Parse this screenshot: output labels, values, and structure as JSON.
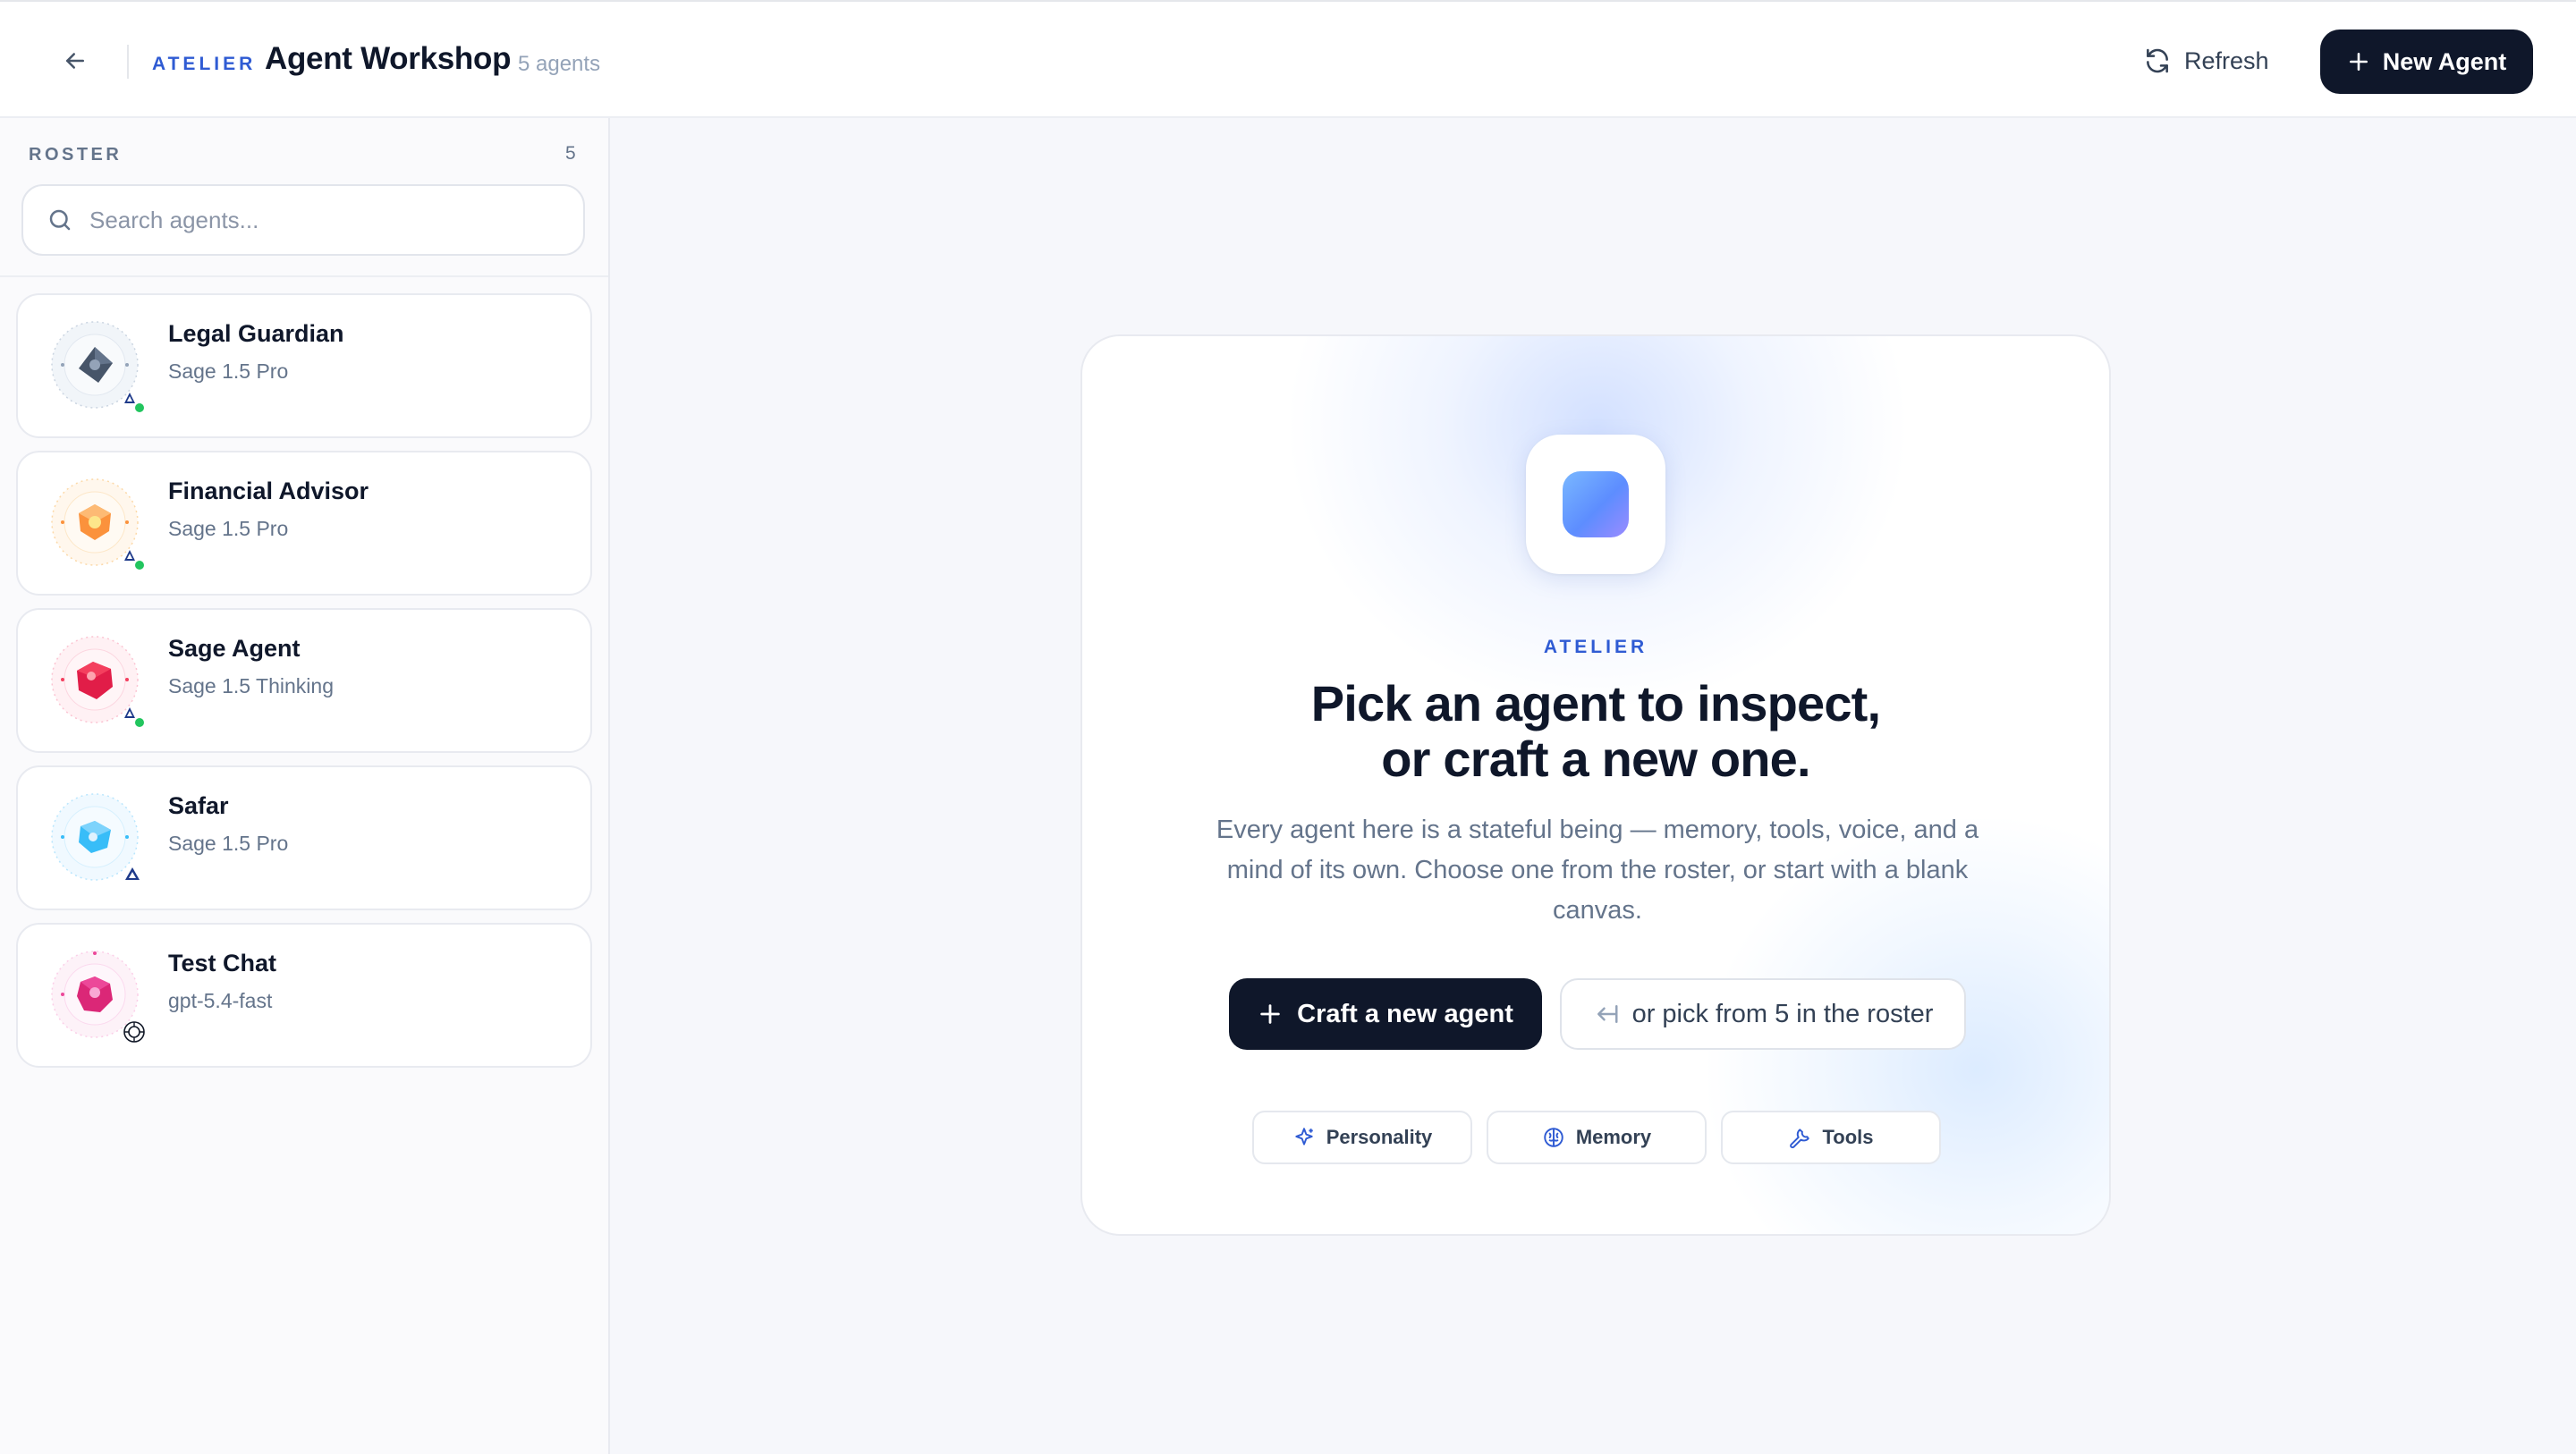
{
  "header": {
    "brand": "ATELIER",
    "title": "Agent Workshop",
    "count_label": "5 agents",
    "refresh_label": "Refresh",
    "new_agent_label": "New Agent"
  },
  "sidebar": {
    "roster_label": "ROSTER",
    "roster_count": "5",
    "search_placeholder": "Search agents...",
    "agents": [
      {
        "name": "Legal Guardian",
        "model": "Sage 1.5 Pro",
        "color": "#475569",
        "ring": "#cbd5e1",
        "badge": "provider-icon",
        "online": true
      },
      {
        "name": "Financial Advisor",
        "model": "Sage 1.5 Pro",
        "color": "#f97316",
        "ring": "#fcd9a8",
        "badge": "provider-icon",
        "online": true
      },
      {
        "name": "Sage Agent",
        "model": "Sage 1.5 Thinking",
        "color": "#e11d48",
        "ring": "#fbc4d2",
        "badge": "provider-icon",
        "online": true
      },
      {
        "name": "Safar",
        "model": "Sage 1.5 Pro",
        "color": "#0ea5e9",
        "ring": "#bae6fd",
        "badge": "provider-icon",
        "online": false
      },
      {
        "name": "Test Chat",
        "model": "gpt-5.4-fast",
        "color": "#db2777",
        "ring": "#fbcfe8",
        "badge": "openai-icon",
        "online": false
      }
    ]
  },
  "hero": {
    "kicker": "ATELIER",
    "title_line1": "Pick an agent to inspect,",
    "title_line2": "or craft a new one.",
    "description": "Every agent here is a stateful being — memory, tools, voice, and a mind of its own. Choose one from the roster, or start with a blank canvas.",
    "craft_label": "Craft a new agent",
    "pick_label": "or pick from 5 in the roster",
    "chips": [
      {
        "label": "Personality",
        "icon": "sparkle-icon"
      },
      {
        "label": "Memory",
        "icon": "brain-icon"
      },
      {
        "label": "Tools",
        "icon": "wrench-icon"
      }
    ]
  },
  "colors": {
    "accent": "#2f5bd3",
    "dark": "#0f172a",
    "online": "#22c55e"
  }
}
